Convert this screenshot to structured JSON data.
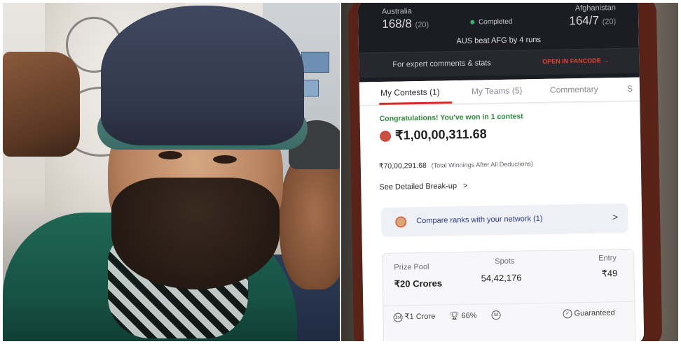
{
  "score_header": {
    "team1_name": "Australia",
    "team1_score": "168/8",
    "team1_overs": "(20)",
    "status": "Completed",
    "team2_name": "Afghanistan",
    "team2_score": "164/7",
    "team2_overs": "(20)",
    "result": "AUS beat AFG by 4 runs",
    "expert_text": "For expert comments & stats",
    "fancode_button": "OPEN IN FANCODE →"
  },
  "tabs": [
    {
      "label": "My Contests (1)",
      "active": true
    },
    {
      "label": "My Teams (5)",
      "active": false
    },
    {
      "label": "Commentary",
      "active": false
    },
    {
      "label": "S",
      "active": false
    }
  ],
  "winnings": {
    "congrats": "Congratulations! You've won in 1 contest",
    "amount": "₹1,00,00,311.68",
    "net_amount": "₹70,00,291.68",
    "net_note": "(Total Winnings After All Deductions)",
    "breakup_link": "See Detailed Break-up",
    "breakup_chevron": ">"
  },
  "compare": {
    "label": "Compare ranks with your network (1)",
    "chevron": ">"
  },
  "contest": {
    "prize_pool_label": "Prize Pool",
    "prize_pool_value": "₹20 Crores",
    "spots_label": "Spots",
    "spots_value": "54,42,176",
    "entry_label": "Entry",
    "entry_value": "₹49",
    "first_prize_badge": "1st",
    "first_prize": "₹1 Crore",
    "win_percent": "66%",
    "multi_badge": "M",
    "guaranteed": "Guaranteed"
  },
  "colors": {
    "accent_red": "#d92b2b",
    "success_green": "#2f8a3f",
    "header_dark": "#1c1d24"
  }
}
